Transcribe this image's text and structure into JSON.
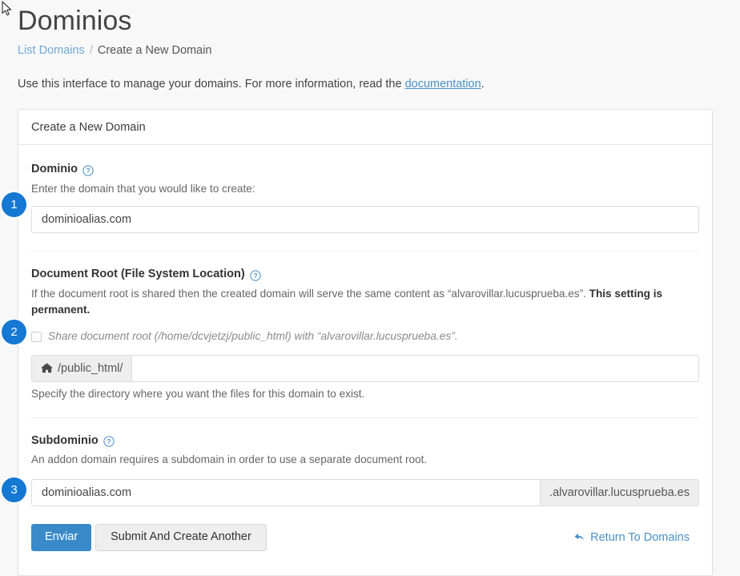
{
  "page": {
    "title": "Dominios",
    "intro_before": "Use this interface to manage your domains. For more information, read the ",
    "intro_link": "documentation",
    "intro_after": "."
  },
  "breadcrumb": {
    "link": "List Domains",
    "separator": "/",
    "current": "Create a New Domain"
  },
  "card": {
    "header": "Create a New Domain"
  },
  "fields": {
    "domain": {
      "label": "Dominio",
      "help_icon": "question-circle-icon",
      "description": "Enter the domain that you would like to create:",
      "value": "dominioalias.com",
      "badge": "1"
    },
    "document_root": {
      "label": "Document Root (File System Location)",
      "help_icon": "question-circle-icon",
      "description_1": "If the document root is shared then the created domain will serve the same content as “alvarovillar.lucusprueba.es”. ",
      "description_bold": "This setting is permanent.",
      "checkbox_label": "Share document root (/home/dcvjetzj/public_html) with “alvarovillar.lucusprueba.es”.",
      "checkbox_checked": false,
      "prefix_icon": "home-icon",
      "prefix_text": "/public_html/",
      "value": "",
      "helper": "Specify the directory where you want the files for this domain to exist.",
      "badge": "2"
    },
    "subdomain": {
      "label": "Subdominio",
      "help_icon": "question-circle-icon",
      "description": "An addon domain requires a subdomain in order to use a separate document root.",
      "value": "dominioalias.com",
      "suffix": ".alvarovillar.lucusprueba.es"
    }
  },
  "actions": {
    "submit": "Enviar",
    "submit_another": "Submit And Create Another",
    "return_link": "Return To Domains",
    "return_icon": "undo-arrow-icon",
    "badge": "3"
  },
  "colors": {
    "accent_blue": "#3a8ac9",
    "badge_blue": "#1578d3",
    "link_blue": "#4a90c4",
    "page_bg": "#f8f8f8"
  }
}
